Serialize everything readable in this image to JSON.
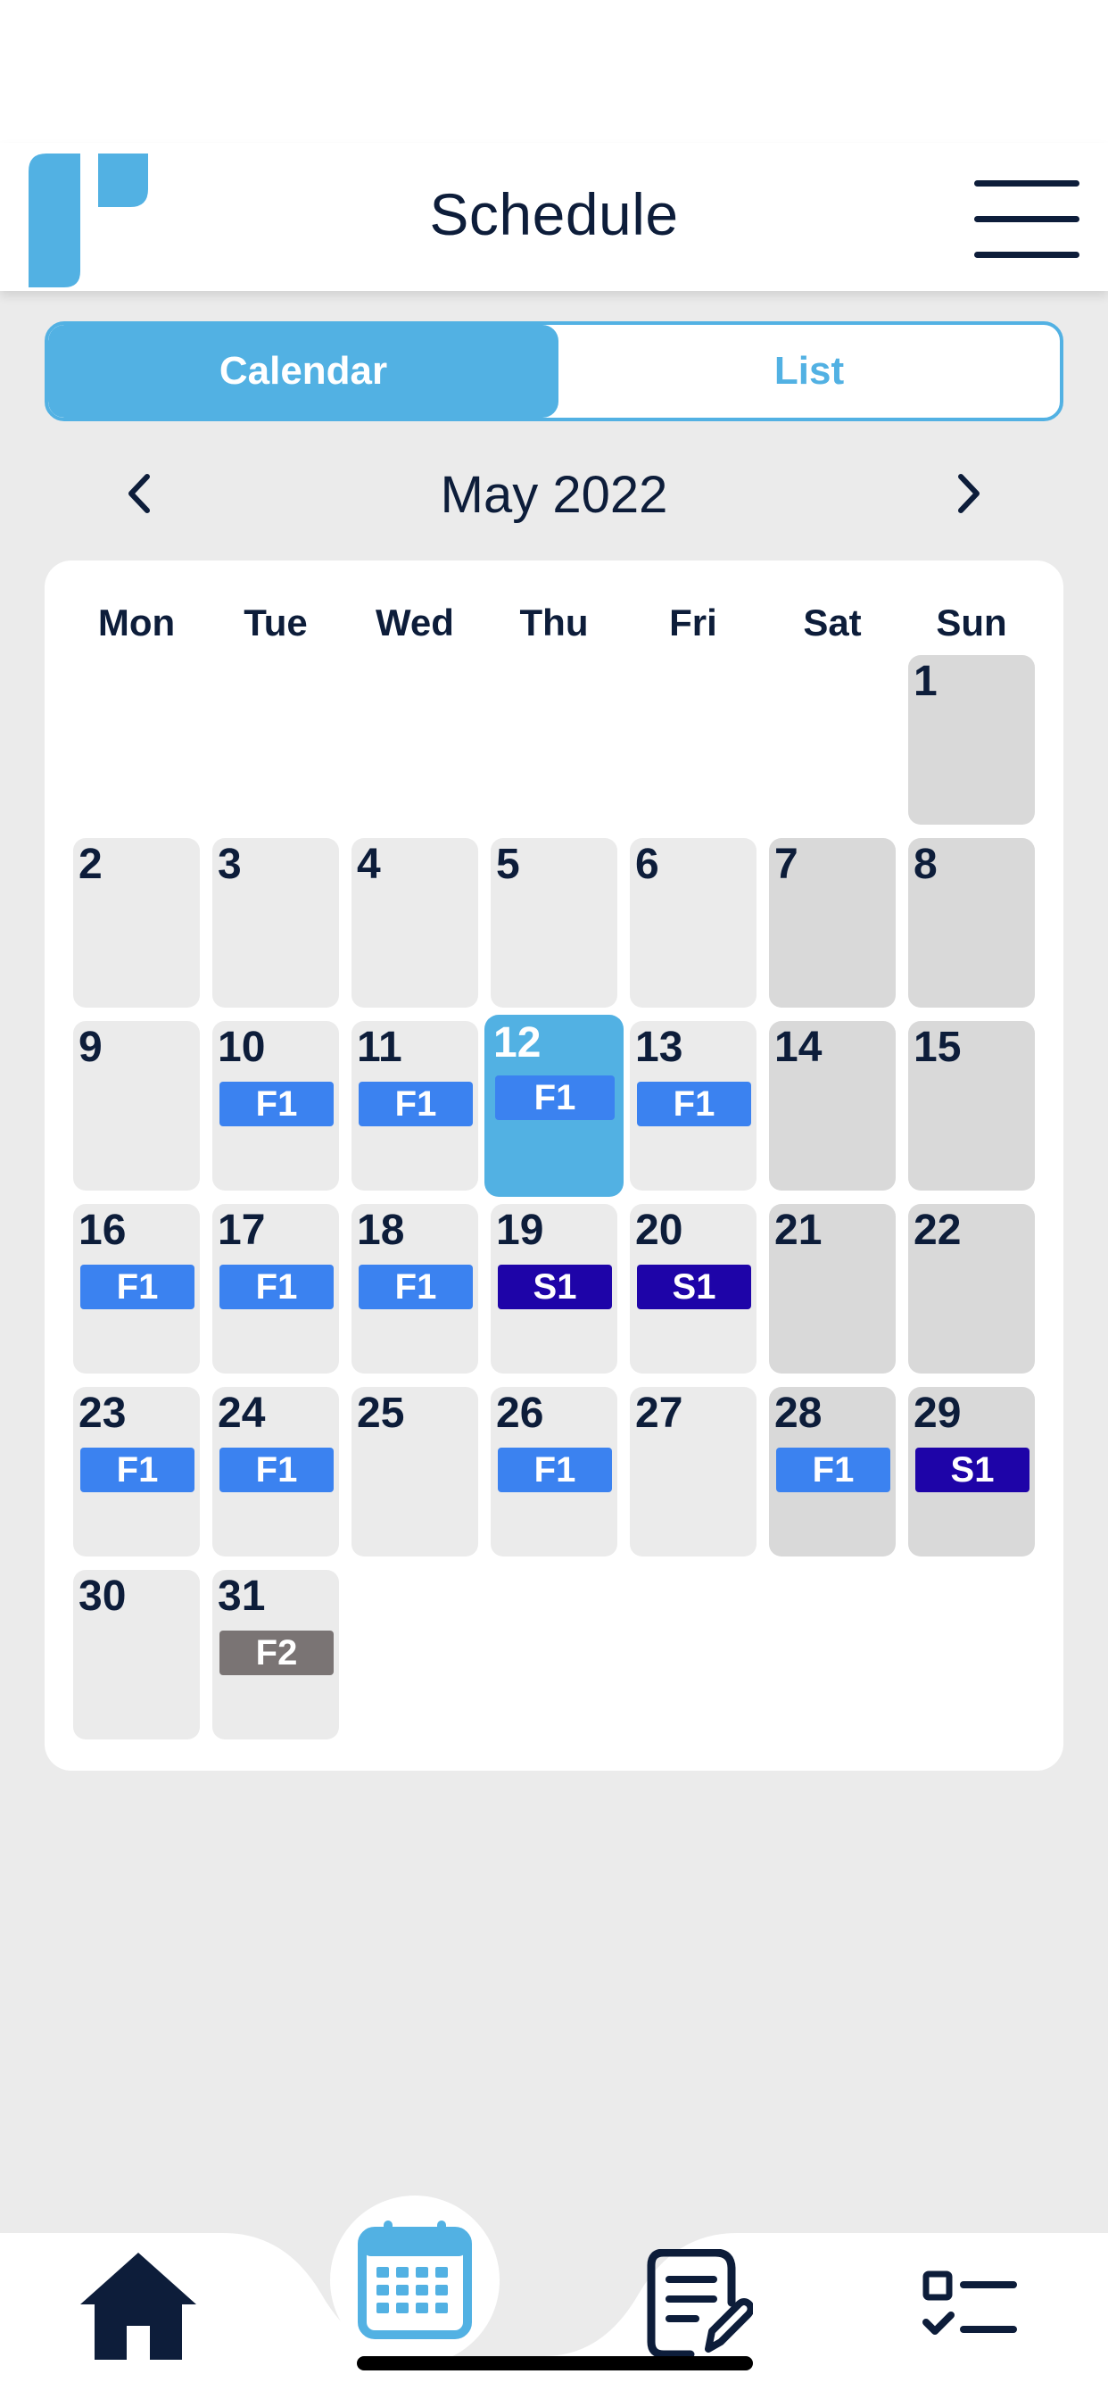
{
  "header": {
    "title": "Schedule"
  },
  "view_toggle": {
    "calendar_label": "Calendar",
    "list_label": "List",
    "active": "Calendar"
  },
  "month_nav": {
    "label": "May 2022"
  },
  "calendar": {
    "weekdays": [
      "Mon",
      "Tue",
      "Wed",
      "Thu",
      "Fri",
      "Sat",
      "Sun"
    ],
    "today": "12",
    "shift_colors": {
      "F1": "#3b82f0",
      "S1": "#1e04a8",
      "F2": "#7a7474"
    },
    "days": [
      {
        "day": "1",
        "shift": ""
      },
      {
        "day": "2",
        "shift": ""
      },
      {
        "day": "3",
        "shift": ""
      },
      {
        "day": "4",
        "shift": ""
      },
      {
        "day": "5",
        "shift": ""
      },
      {
        "day": "6",
        "shift": ""
      },
      {
        "day": "7",
        "shift": ""
      },
      {
        "day": "8",
        "shift": ""
      },
      {
        "day": "9",
        "shift": ""
      },
      {
        "day": "10",
        "shift": "F1"
      },
      {
        "day": "11",
        "shift": "F1"
      },
      {
        "day": "12",
        "shift": "F1"
      },
      {
        "day": "13",
        "shift": "F1"
      },
      {
        "day": "14",
        "shift": ""
      },
      {
        "day": "15",
        "shift": ""
      },
      {
        "day": "16",
        "shift": "F1"
      },
      {
        "day": "17",
        "shift": "F1"
      },
      {
        "day": "18",
        "shift": "F1"
      },
      {
        "day": "19",
        "shift": "S1"
      },
      {
        "day": "20",
        "shift": "S1"
      },
      {
        "day": "21",
        "shift": ""
      },
      {
        "day": "22",
        "shift": ""
      },
      {
        "day": "23",
        "shift": "F1"
      },
      {
        "day": "24",
        "shift": "F1"
      },
      {
        "day": "25",
        "shift": ""
      },
      {
        "day": "26",
        "shift": "F1"
      },
      {
        "day": "27",
        "shift": ""
      },
      {
        "day": "28",
        "shift": "F1"
      },
      {
        "day": "29",
        "shift": "S1"
      },
      {
        "day": "30",
        "shift": ""
      },
      {
        "day": "31",
        "shift": "F2"
      }
    ]
  },
  "bottom_nav": {
    "items": [
      {
        "icon": "home-icon",
        "active": false
      },
      {
        "icon": "calendar-icon",
        "active": true
      },
      {
        "icon": "notes-icon",
        "active": false
      },
      {
        "icon": "tasks-icon",
        "active": false
      }
    ]
  },
  "colors": {
    "accent": "#52b1e3",
    "text_dark": "#0d1d3a",
    "background": "#ebebeb",
    "weekday_cell": "#ebebeb",
    "weekend_cell": "#d9d9d9"
  }
}
